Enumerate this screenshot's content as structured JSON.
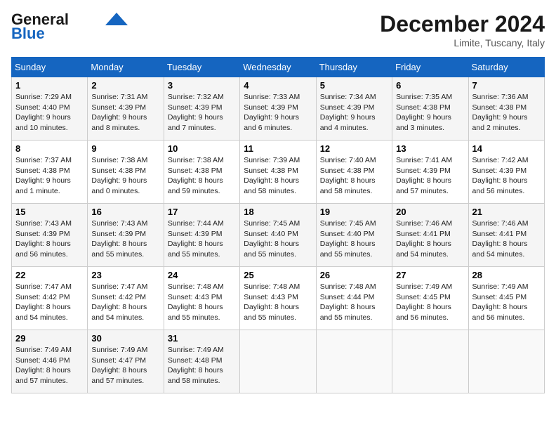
{
  "header": {
    "logo_line1": "General",
    "logo_line2": "Blue",
    "month_title": "December 2024",
    "location": "Limite, Tuscany, Italy"
  },
  "days_of_week": [
    "Sunday",
    "Monday",
    "Tuesday",
    "Wednesday",
    "Thursday",
    "Friday",
    "Saturday"
  ],
  "weeks": [
    [
      {
        "day": "1",
        "sunrise": "Sunrise: 7:29 AM",
        "sunset": "Sunset: 4:40 PM",
        "daylight": "Daylight: 9 hours and 10 minutes."
      },
      {
        "day": "2",
        "sunrise": "Sunrise: 7:31 AM",
        "sunset": "Sunset: 4:39 PM",
        "daylight": "Daylight: 9 hours and 8 minutes."
      },
      {
        "day": "3",
        "sunrise": "Sunrise: 7:32 AM",
        "sunset": "Sunset: 4:39 PM",
        "daylight": "Daylight: 9 hours and 7 minutes."
      },
      {
        "day": "4",
        "sunrise": "Sunrise: 7:33 AM",
        "sunset": "Sunset: 4:39 PM",
        "daylight": "Daylight: 9 hours and 6 minutes."
      },
      {
        "day": "5",
        "sunrise": "Sunrise: 7:34 AM",
        "sunset": "Sunset: 4:39 PM",
        "daylight": "Daylight: 9 hours and 4 minutes."
      },
      {
        "day": "6",
        "sunrise": "Sunrise: 7:35 AM",
        "sunset": "Sunset: 4:38 PM",
        "daylight": "Daylight: 9 hours and 3 minutes."
      },
      {
        "day": "7",
        "sunrise": "Sunrise: 7:36 AM",
        "sunset": "Sunset: 4:38 PM",
        "daylight": "Daylight: 9 hours and 2 minutes."
      }
    ],
    [
      {
        "day": "8",
        "sunrise": "Sunrise: 7:37 AM",
        "sunset": "Sunset: 4:38 PM",
        "daylight": "Daylight: 9 hours and 1 minute."
      },
      {
        "day": "9",
        "sunrise": "Sunrise: 7:38 AM",
        "sunset": "Sunset: 4:38 PM",
        "daylight": "Daylight: 9 hours and 0 minutes."
      },
      {
        "day": "10",
        "sunrise": "Sunrise: 7:38 AM",
        "sunset": "Sunset: 4:38 PM",
        "daylight": "Daylight: 8 hours and 59 minutes."
      },
      {
        "day": "11",
        "sunrise": "Sunrise: 7:39 AM",
        "sunset": "Sunset: 4:38 PM",
        "daylight": "Daylight: 8 hours and 58 minutes."
      },
      {
        "day": "12",
        "sunrise": "Sunrise: 7:40 AM",
        "sunset": "Sunset: 4:38 PM",
        "daylight": "Daylight: 8 hours and 58 minutes."
      },
      {
        "day": "13",
        "sunrise": "Sunrise: 7:41 AM",
        "sunset": "Sunset: 4:39 PM",
        "daylight": "Daylight: 8 hours and 57 minutes."
      },
      {
        "day": "14",
        "sunrise": "Sunrise: 7:42 AM",
        "sunset": "Sunset: 4:39 PM",
        "daylight": "Daylight: 8 hours and 56 minutes."
      }
    ],
    [
      {
        "day": "15",
        "sunrise": "Sunrise: 7:43 AM",
        "sunset": "Sunset: 4:39 PM",
        "daylight": "Daylight: 8 hours and 56 minutes."
      },
      {
        "day": "16",
        "sunrise": "Sunrise: 7:43 AM",
        "sunset": "Sunset: 4:39 PM",
        "daylight": "Daylight: 8 hours and 55 minutes."
      },
      {
        "day": "17",
        "sunrise": "Sunrise: 7:44 AM",
        "sunset": "Sunset: 4:39 PM",
        "daylight": "Daylight: 8 hours and 55 minutes."
      },
      {
        "day": "18",
        "sunrise": "Sunrise: 7:45 AM",
        "sunset": "Sunset: 4:40 PM",
        "daylight": "Daylight: 8 hours and 55 minutes."
      },
      {
        "day": "19",
        "sunrise": "Sunrise: 7:45 AM",
        "sunset": "Sunset: 4:40 PM",
        "daylight": "Daylight: 8 hours and 55 minutes."
      },
      {
        "day": "20",
        "sunrise": "Sunrise: 7:46 AM",
        "sunset": "Sunset: 4:41 PM",
        "daylight": "Daylight: 8 hours and 54 minutes."
      },
      {
        "day": "21",
        "sunrise": "Sunrise: 7:46 AM",
        "sunset": "Sunset: 4:41 PM",
        "daylight": "Daylight: 8 hours and 54 minutes."
      }
    ],
    [
      {
        "day": "22",
        "sunrise": "Sunrise: 7:47 AM",
        "sunset": "Sunset: 4:42 PM",
        "daylight": "Daylight: 8 hours and 54 minutes."
      },
      {
        "day": "23",
        "sunrise": "Sunrise: 7:47 AM",
        "sunset": "Sunset: 4:42 PM",
        "daylight": "Daylight: 8 hours and 54 minutes."
      },
      {
        "day": "24",
        "sunrise": "Sunrise: 7:48 AM",
        "sunset": "Sunset: 4:43 PM",
        "daylight": "Daylight: 8 hours and 55 minutes."
      },
      {
        "day": "25",
        "sunrise": "Sunrise: 7:48 AM",
        "sunset": "Sunset: 4:43 PM",
        "daylight": "Daylight: 8 hours and 55 minutes."
      },
      {
        "day": "26",
        "sunrise": "Sunrise: 7:48 AM",
        "sunset": "Sunset: 4:44 PM",
        "daylight": "Daylight: 8 hours and 55 minutes."
      },
      {
        "day": "27",
        "sunrise": "Sunrise: 7:49 AM",
        "sunset": "Sunset: 4:45 PM",
        "daylight": "Daylight: 8 hours and 56 minutes."
      },
      {
        "day": "28",
        "sunrise": "Sunrise: 7:49 AM",
        "sunset": "Sunset: 4:45 PM",
        "daylight": "Daylight: 8 hours and 56 minutes."
      }
    ],
    [
      {
        "day": "29",
        "sunrise": "Sunrise: 7:49 AM",
        "sunset": "Sunset: 4:46 PM",
        "daylight": "Daylight: 8 hours and 57 minutes."
      },
      {
        "day": "30",
        "sunrise": "Sunrise: 7:49 AM",
        "sunset": "Sunset: 4:47 PM",
        "daylight": "Daylight: 8 hours and 57 minutes."
      },
      {
        "day": "31",
        "sunrise": "Sunrise: 7:49 AM",
        "sunset": "Sunset: 4:48 PM",
        "daylight": "Daylight: 8 hours and 58 minutes."
      },
      null,
      null,
      null,
      null
    ]
  ]
}
